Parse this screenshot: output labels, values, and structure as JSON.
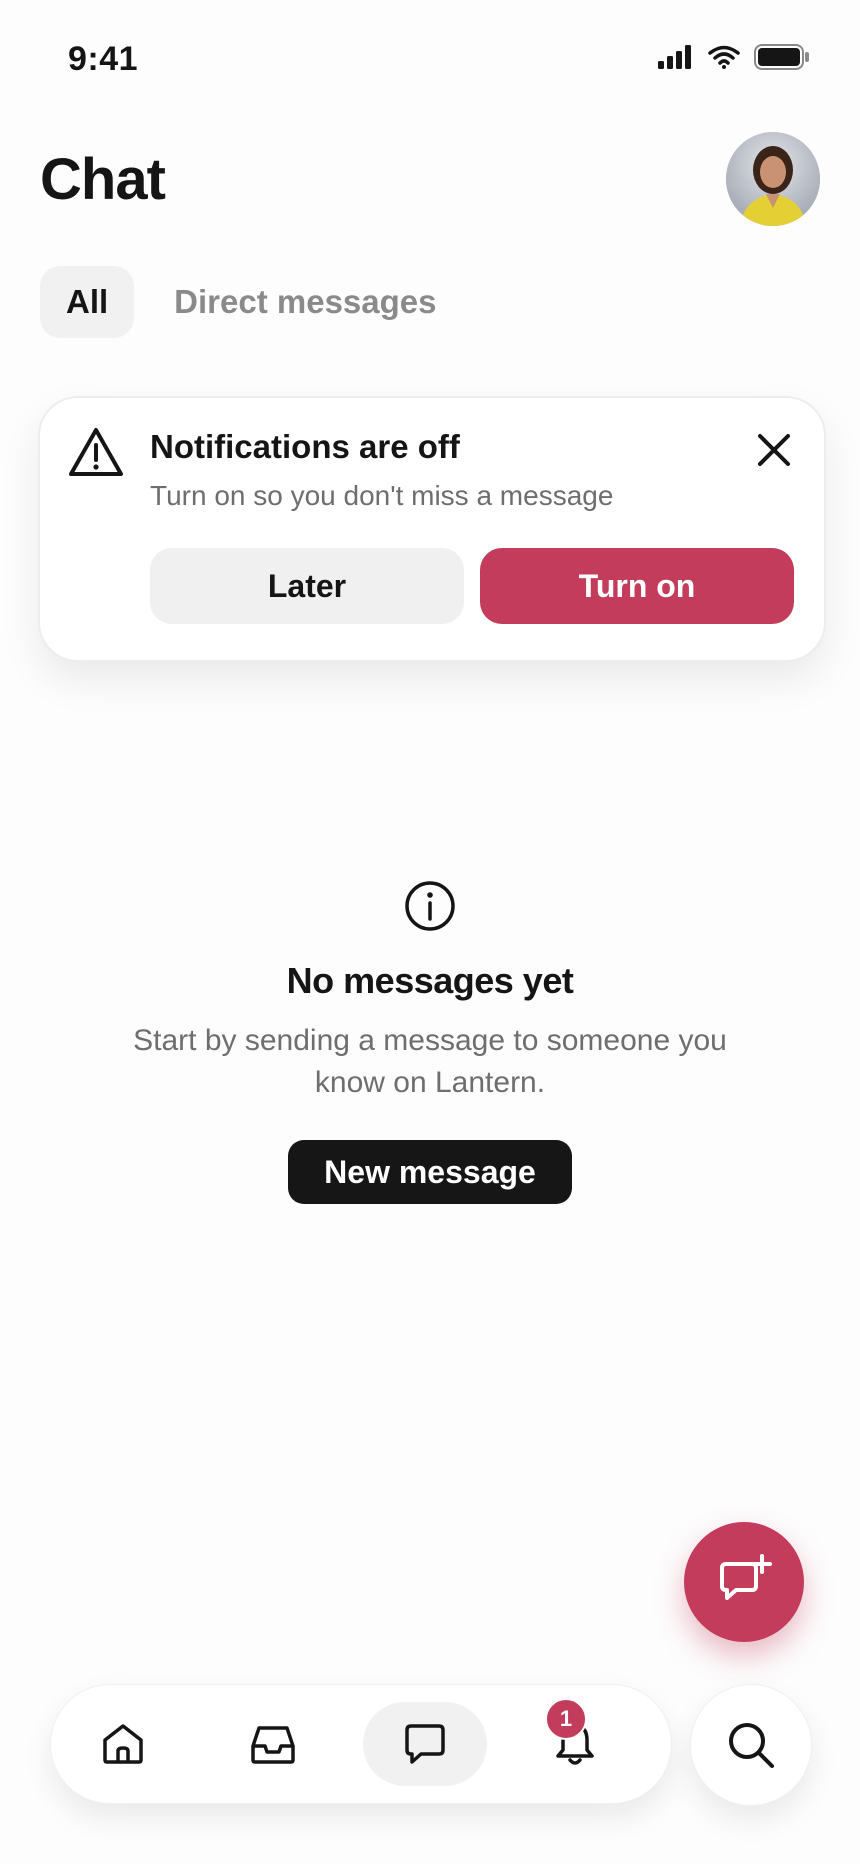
{
  "status_bar": {
    "time": "9:41"
  },
  "header": {
    "title": "Chat"
  },
  "tabs": [
    {
      "label": "All",
      "active": true
    },
    {
      "label": "Direct messages",
      "active": false
    }
  ],
  "notification": {
    "title": "Notifications are off",
    "subtitle": "Turn on so you don't miss a message",
    "later_label": "Later",
    "turn_on_label": "Turn on"
  },
  "empty_state": {
    "title": "No messages yet",
    "subtitle": "Start by sending a message to someone you know on Lantern.",
    "button_label": "New message"
  },
  "bottom_nav": {
    "items": [
      "home-icon",
      "inbox-icon",
      "chat-icon",
      "bell-icon"
    ],
    "active": "chat-icon",
    "notification_count": "1"
  },
  "colors": {
    "accent": "#c43c5c",
    "dark_button": "#161616",
    "muted_text": "#6e6e6e"
  }
}
